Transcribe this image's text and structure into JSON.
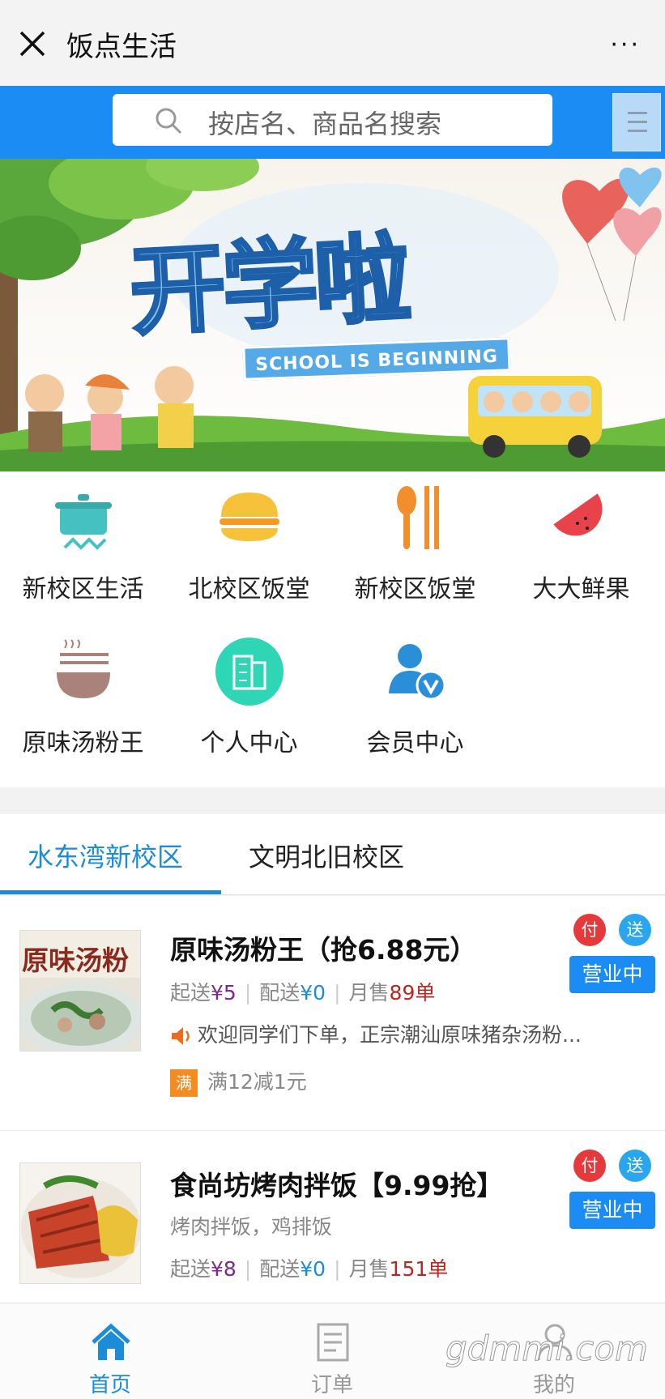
{
  "nav": {
    "title": "饭点生活",
    "more": "···"
  },
  "search": {
    "placeholder": "按店名、商品名搜索"
  },
  "banner": {
    "title": "开学啦",
    "subtitle": "SCHOOL IS BEGINNING"
  },
  "categories": [
    {
      "label": "新校区生活",
      "icon": "cooking-pot-icon"
    },
    {
      "label": "北校区饭堂",
      "icon": "burger-icon"
    },
    {
      "label": "新校区饭堂",
      "icon": "spoon-chopsticks-icon"
    },
    {
      "label": "大大鲜果",
      "icon": "watermelon-icon"
    },
    {
      "label": "原味汤粉王",
      "icon": "noodle-bowl-icon"
    },
    {
      "label": "个人中心",
      "icon": "building-icon"
    },
    {
      "label": "会员中心",
      "icon": "vip-user-icon"
    }
  ],
  "tabs": [
    {
      "label": "水东湾新校区",
      "active": true
    },
    {
      "label": "文明北旧校区",
      "active": false
    }
  ],
  "stores": [
    {
      "thumb_text": "原味汤粉",
      "name": "原味汤粉王（抢6.88元）",
      "min_label": "起送",
      "min_value": "¥5",
      "fee_label": "配送",
      "fee_value": "¥0",
      "sales_label": "月售",
      "sales_value": "89单",
      "notice": "欢迎同学们下单，正宗潮汕原味猪杂汤粉...",
      "promo_badge": "满",
      "promo_text": "满12减1元",
      "pay_badge": "付",
      "send_badge": "送",
      "status": "营业中"
    },
    {
      "name": "食尚坊烤肉拌饭【9.99抢】",
      "desc": "烤肉拌饭，鸡排饭",
      "min_label": "起送",
      "min_value": "¥8",
      "fee_label": "配送",
      "fee_value": "¥0",
      "sales_label": "月售",
      "sales_value": "151单",
      "pay_badge": "付",
      "send_badge": "送",
      "status": "营业中"
    }
  ],
  "tabbar": [
    {
      "label": "首页",
      "icon": "home-icon",
      "active": true
    },
    {
      "label": "订单",
      "icon": "order-icon",
      "active": false
    },
    {
      "label": "我的",
      "icon": "profile-icon",
      "active": false
    }
  ],
  "watermark": "gdmmi.com",
  "colors": {
    "brand_blue": "#1a8cf3",
    "active_tab": "#1a8cd8",
    "price_purple": "#7b2a86",
    "sales_red": "#c0241f",
    "promo_orange": "#f58c22"
  }
}
